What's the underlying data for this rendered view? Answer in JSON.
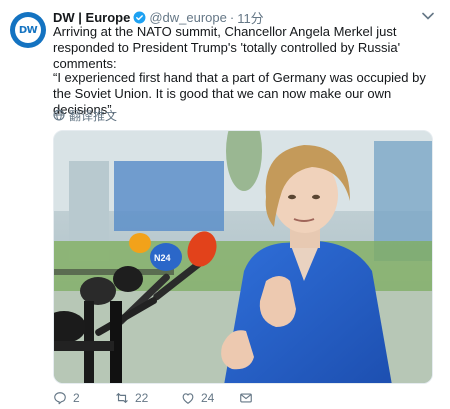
{
  "account": {
    "display_name": "DW | Europe",
    "handle": "@dw_europe",
    "separator": "·",
    "time": "11分",
    "avatar_text": "DW"
  },
  "tweet": {
    "text_line1": "Arriving at the NATO summit, Chancellor Angela Merkel just responded to President Trump's 'totally controlled by Russia' comments:",
    "text_line2": "“I experienced first hand that a part of Germany was occupied by the Soviet Union. It is good that we can now make our own decisions”.",
    "translate_label": "翻译推文"
  },
  "media": {
    "mic_label": "N24"
  },
  "actions": {
    "reply_count": "2",
    "retweet_count": "22",
    "like_count": "24"
  },
  "colors": {
    "accent": "#1b95e0",
    "brand": "#1473c1",
    "muted": "#657786"
  }
}
